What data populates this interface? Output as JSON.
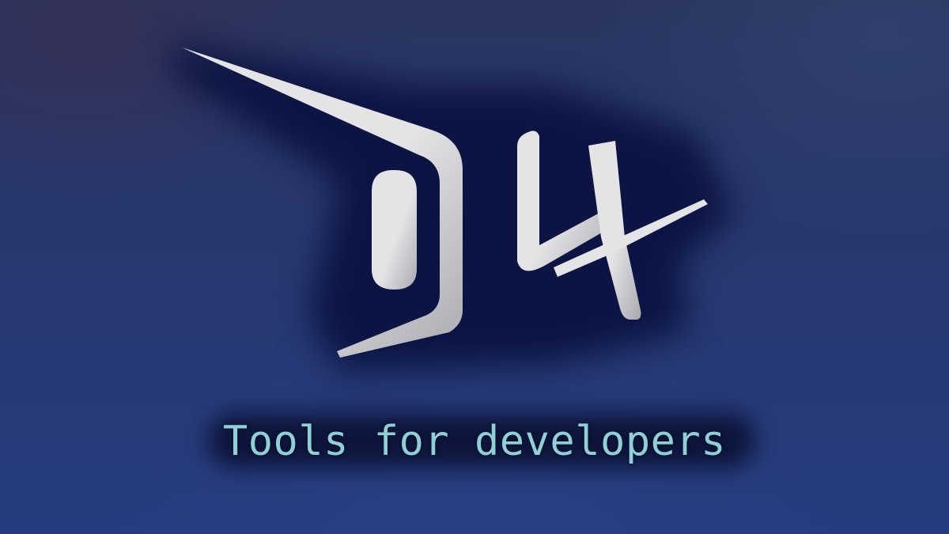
{
  "background": {
    "color_top": "#2a3560",
    "color_bottom": "#263c80",
    "glow_color": "#0a1240"
  },
  "logo": {
    "icon": "d4-logo-icon",
    "fill_light": "#e4e4e6",
    "fill_dark": "#a9aab0"
  },
  "tagline": {
    "text": "Tools for developers",
    "color": "#8fd0d8"
  }
}
